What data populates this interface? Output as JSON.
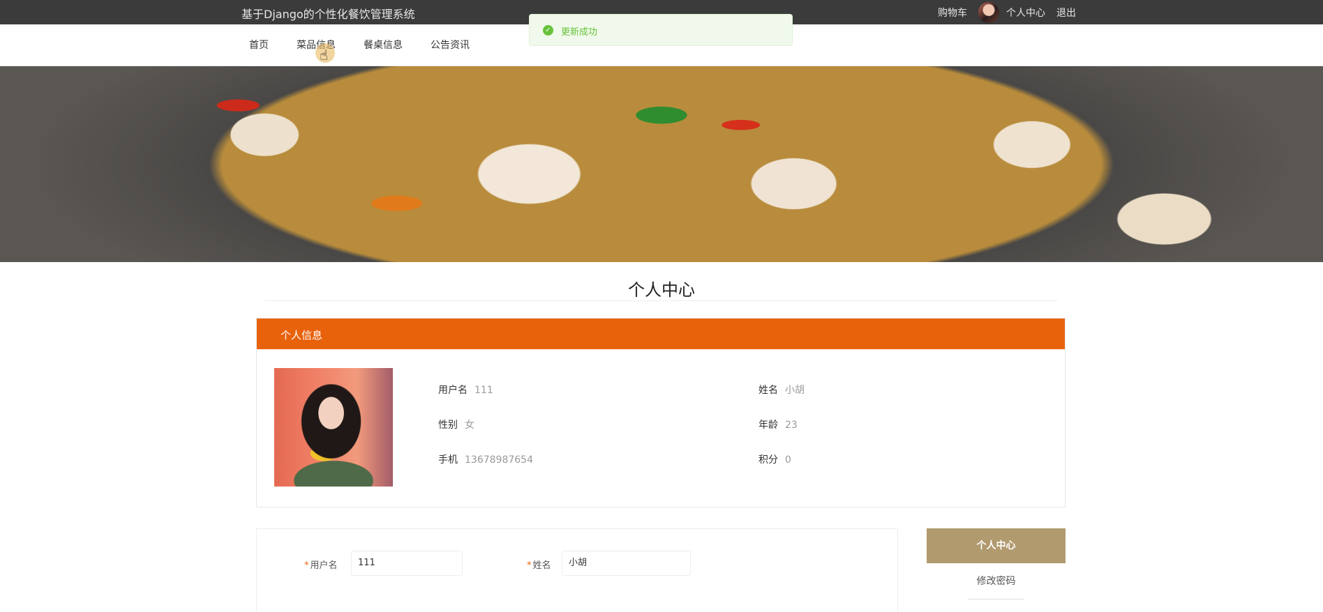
{
  "header": {
    "site_title": "基于Django的个性化餐饮管理系统",
    "cart": "购物车",
    "user_center": "个人中心",
    "logout": "退出"
  },
  "nav": {
    "items": [
      "首页",
      "菜品信息",
      "餐桌信息",
      "公告资讯"
    ],
    "hovered": "菜品信息"
  },
  "toast": {
    "message": "更新成功",
    "type": "success",
    "color": "#67c23a"
  },
  "banner": {
    "slide_count": 3,
    "active_slide": 1
  },
  "page_title": "个人中心",
  "info": {
    "header": "个人信息",
    "fields": [
      {
        "label": "用户名",
        "value": "111"
      },
      {
        "label": "姓名",
        "value": "小胡"
      },
      {
        "label": "性别",
        "value": "女"
      },
      {
        "label": "年龄",
        "value": "23"
      },
      {
        "label": "手机",
        "value": "13678987654"
      },
      {
        "label": "积分",
        "value": "0"
      }
    ]
  },
  "form": {
    "username_label": "用户名",
    "username_value": "111",
    "name_label": "姓名",
    "name_value": "小胡",
    "required_mark": "*"
  },
  "side_menu": {
    "active": "个人中心",
    "items": [
      "修改密码"
    ]
  },
  "colors": {
    "accent": "#e8620c",
    "side_active": "#b09a6e",
    "topbar": "#3b3b3b"
  }
}
